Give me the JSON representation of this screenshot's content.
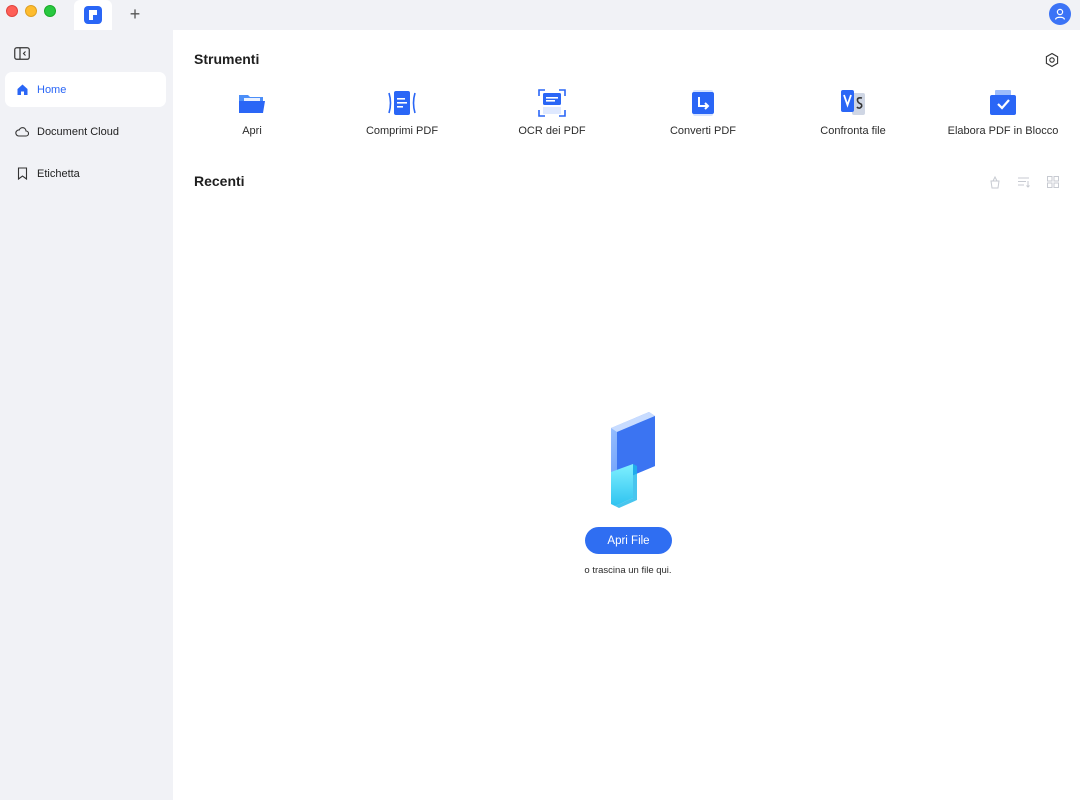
{
  "window": {
    "colors": {
      "accent": "#2a66f6",
      "sidebar_bg": "#f1f2f6",
      "window_bg": "#ffffff"
    },
    "new_tab_label": "+"
  },
  "sidebar": {
    "items": [
      {
        "label": "Home",
        "icon": "home-icon",
        "active": true
      },
      {
        "label": "Document Cloud",
        "icon": "cloud-icon",
        "active": false
      },
      {
        "label": "Etichetta",
        "icon": "bookmark-icon",
        "active": false
      }
    ]
  },
  "tools": {
    "title": "Strumenti",
    "items": [
      {
        "label": "Apri",
        "icon": "open-folder-icon"
      },
      {
        "label": "Comprimi PDF",
        "icon": "compress-pdf-icon"
      },
      {
        "label": "OCR dei PDF",
        "icon": "ocr-icon"
      },
      {
        "label": "Converti PDF",
        "icon": "convert-icon"
      },
      {
        "label": "Confronta file",
        "icon": "compare-icon"
      },
      {
        "label": "Elabora PDF in Blocco",
        "icon": "batch-process-icon"
      }
    ]
  },
  "recent": {
    "title": "Recenti",
    "empty_state": {
      "button_label": "Apri File",
      "hint": "o trascina un file qui."
    }
  }
}
